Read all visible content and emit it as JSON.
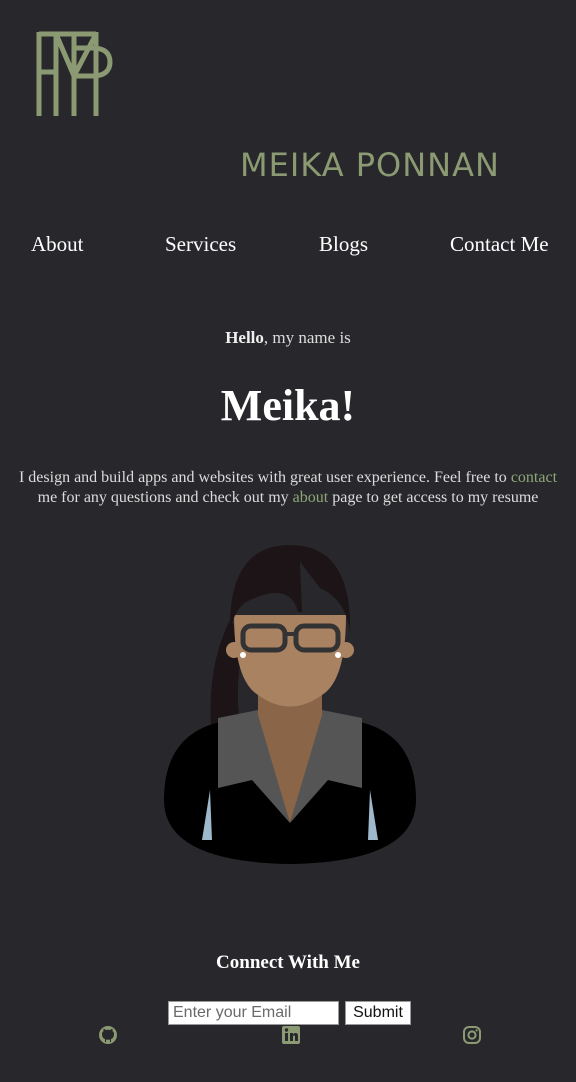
{
  "brand": {
    "name": "MEIKA PONNAN",
    "logo_icon": "mp-monogram-logo",
    "accent_color": "#8b9a72"
  },
  "nav": {
    "items": [
      "About",
      "Services",
      "Blogs",
      "Contact Me"
    ]
  },
  "hero": {
    "hello_bold": "Hello",
    "hello_rest": ", my name is",
    "name": "Meika!",
    "intro_part1": "I design and build apps and websites with great user experience. Feel free to ",
    "contact_link": "contact",
    "intro_part2": " me for any questions and check out my ",
    "about_link": "about",
    "intro_part3": " page to get access to my resume",
    "link_color": "#8fa678",
    "avatar": "woman-with-glasses-avatar"
  },
  "footer": {
    "connect_title": "Connect With Me",
    "email_placeholder": "Enter your Email",
    "submit_label": "Submit",
    "social_icons": [
      "github-icon",
      "linkedin-icon",
      "instagram-icon"
    ]
  },
  "colors": {
    "background": "#28282c",
    "text": "#ffffff"
  }
}
